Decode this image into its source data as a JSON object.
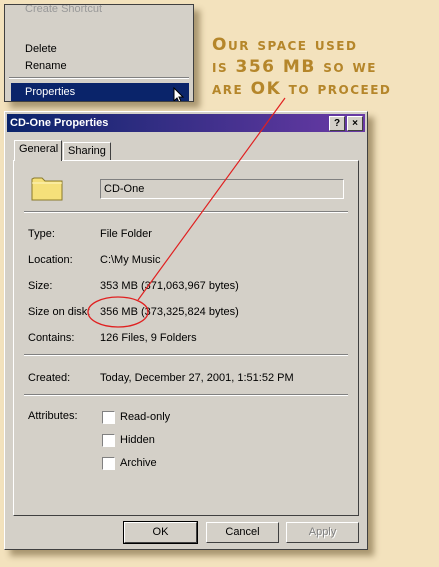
{
  "context_menu": {
    "items": [
      {
        "label": "Create Shortcut"
      },
      {
        "label": "Delete"
      },
      {
        "label": "Rename"
      },
      {
        "label": "Properties"
      }
    ]
  },
  "annotation": {
    "text": "Our space used\nis 356 MB so we\nare OK to proceed",
    "color": "#b5862a"
  },
  "dialog": {
    "title": "CD-One Properties",
    "help_button": "?",
    "close_button": "×",
    "tabs": [
      {
        "label": "General"
      },
      {
        "label": "Sharing"
      }
    ],
    "name_value": "CD-One",
    "fields": [
      {
        "label": "Type:",
        "value": "File Folder"
      },
      {
        "label": "Location:",
        "value": "C:\\My Music"
      },
      {
        "label": "Size:",
        "value": "353 MB (371,063,967 bytes)"
      },
      {
        "label": "Size on disk:",
        "value": "356 MB (373,325,824 bytes)"
      },
      {
        "label": "Contains:",
        "value": "126 Files, 9 Folders"
      }
    ],
    "created": {
      "label": "Created:",
      "value": "Today, December 27, 2001, 1:51:52 PM"
    },
    "attributes": {
      "label": "Attributes:",
      "options": [
        {
          "label": "Read-only",
          "checked": false
        },
        {
          "label": "Hidden",
          "checked": false
        },
        {
          "label": "Archive",
          "checked": false
        }
      ]
    },
    "buttons": {
      "ok": "OK",
      "cancel": "Cancel",
      "apply": "Apply"
    }
  },
  "colors": {
    "background": "#f3e2bd",
    "titlebar_start": "#0a246a",
    "titlebar_end": "#6a3aa6",
    "highlight_ellipse": "#e02020"
  }
}
